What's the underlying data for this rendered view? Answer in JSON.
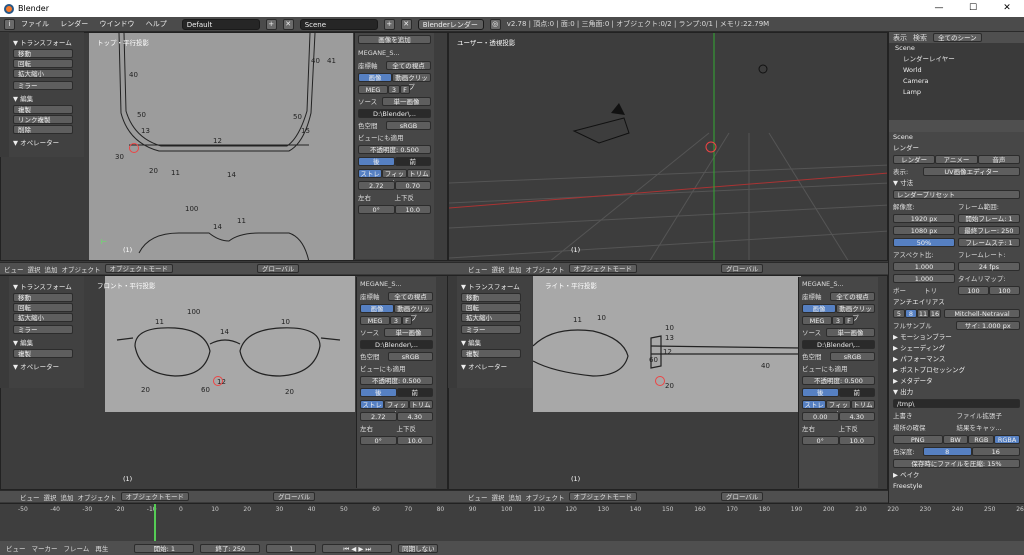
{
  "window": {
    "title": "Blender",
    "min": "—",
    "max": "☐",
    "close": "✕"
  },
  "info": {
    "menus": [
      "ファイル",
      "レンダー",
      "ウインドウ",
      "ヘルプ"
    ],
    "layout": "Default",
    "scene": "Scene",
    "engine": "Blenderレンダー",
    "stats": "v2.78 | 頂点:0 | 面:0 | 三角面:0 | オブジェクト:0/2 | ランプ:0/1 | メモリ:22.79M"
  },
  "toolshelf": {
    "transform": "▼ トランスフォーム",
    "move": "移動",
    "rotate": "回転",
    "scale": "拡大縮小",
    "mirror": "ミラー",
    "edit": "▼ 編集",
    "duplicate": "複製",
    "link_dup": "リンク複製",
    "delete": "削除",
    "operator": "▼ オペレーター"
  },
  "viewports": {
    "top": "トップ・平行投影",
    "persp": "ユーザー・透視投影",
    "front": "フロント・平行投影",
    "right": "ライト・平行投影",
    "frame": "(1)"
  },
  "bgpanel": {
    "add": "画像を追加",
    "name": "MEGANE_S...",
    "axis_label": "座標軸",
    "axis": "全ての視点",
    "image": "画像",
    "clip": "動画クリップ",
    "img_name": "MEG",
    "source_label": "ソース",
    "source": "単一画像",
    "path": "D:\\Blender\\...",
    "colorspace_label": "色空間",
    "colorspace": "sRGB",
    "view_as_render": "ビューにも適用",
    "opacity": "不透明度:",
    "opacity_val": "0.500",
    "back": "後",
    "front": "前",
    "stretch": "ストレ",
    "fit": "フィット",
    "crop": "トリム",
    "x_top": "2.72",
    "y_top": "0.70",
    "x_front": "2.72",
    "y_front": "4.30",
    "x_right": "0.00",
    "y_right": "4.30",
    "flip_x": "左右",
    "flip_y": "上下反",
    "rot": "0°",
    "size": "10.0"
  },
  "header3d": {
    "view": "ビュー",
    "select": "選択",
    "add": "追加",
    "object": "オブジェクト",
    "mode": "オブジェクトモード",
    "orient": "グローバル"
  },
  "outliner": {
    "view": "表示",
    "search": "検索",
    "scope": "全てのシーン",
    "items": [
      "Scene",
      "レンダーレイヤー",
      "World",
      "Camera",
      "Lamp"
    ]
  },
  "properties": {
    "scene": "Scene",
    "render": "レンダー",
    "render_btn": "レンダー",
    "anim": "アニメー",
    "audio": "音声",
    "display": "表示:",
    "display_val": "UV画像エディター",
    "dims": "▼ 寸法",
    "preset": "レンダープリセット",
    "resolution": "解像度:",
    "res_x": "X:",
    "res_x_val": "1920 px",
    "res_y": "Y:",
    "res_y_val": "1080 px",
    "res_pct": "50%",
    "frame_range": "フレーム範囲:",
    "start": "開始フレーム: 1",
    "end": "最終フレー: 250",
    "step": "フレームステ: 1",
    "aspect": "アスペクト比:",
    "asp_x": "1.000",
    "asp_y": "1.000",
    "framerate": "フレームレート:",
    "fps": "24 fps",
    "remap": "タイムリマップ:",
    "remap_old": "100",
    "remap_new": "100",
    "border": "ボー",
    "crop": "トリ",
    "aa": "アンチエイリアス",
    "aa_vals": [
      "5",
      "8",
      "11",
      "16"
    ],
    "aa_filter": "Mitchell-Netraval",
    "fullsample": "フルサンプル",
    "size": "サイ: 1.000 px",
    "motion_blur": "▶ モーションブラー",
    "shading": "▶ シェーディング",
    "performance": "▶ パフォーマンス",
    "post": "▶ ポストプロセッシング",
    "metadata": "▶ メタデータ",
    "output": "▼ 出力",
    "path": "/tmp\\",
    "overwrite": "上書き",
    "file_ext": "ファイル拡張子",
    "placeholders": "場所の確保",
    "cache": "結果をキャッ...",
    "format": "PNG",
    "bw": "BW",
    "rgb": "RGB",
    "rgba": "RGBA",
    "depth_label": "色深度:",
    "depth8": "8",
    "depth16": "16",
    "compress": "保存時にファイルを圧縮:",
    "compress_val": "15%",
    "bake": "▶ ベイク",
    "freestyle": "Freestyle"
  },
  "timeline": {
    "ticks": [
      "-50",
      "-40",
      "-30",
      "-20",
      "-10",
      "0",
      "10",
      "20",
      "30",
      "40",
      "50",
      "60",
      "70",
      "80",
      "90",
      "100",
      "110",
      "120",
      "130",
      "140",
      "150",
      "160",
      "170",
      "180",
      "190",
      "200",
      "210",
      "220",
      "230",
      "240",
      "250",
      "260"
    ],
    "view": "ビュー",
    "marker": "マーカー",
    "frame": "フレーム",
    "playback": "再生",
    "start": "開始:",
    "start_val": "1",
    "end": "終了:",
    "end_val": "250",
    "current": "1",
    "sync": "同期しない"
  },
  "drawing_labels": [
    "40",
    "41",
    "50",
    "13",
    "30",
    "20",
    "11",
    "12",
    "14",
    "15",
    "40",
    "50",
    "60",
    "100",
    "12",
    "11",
    "10",
    "40",
    "20",
    "60",
    "10",
    "13"
  ]
}
